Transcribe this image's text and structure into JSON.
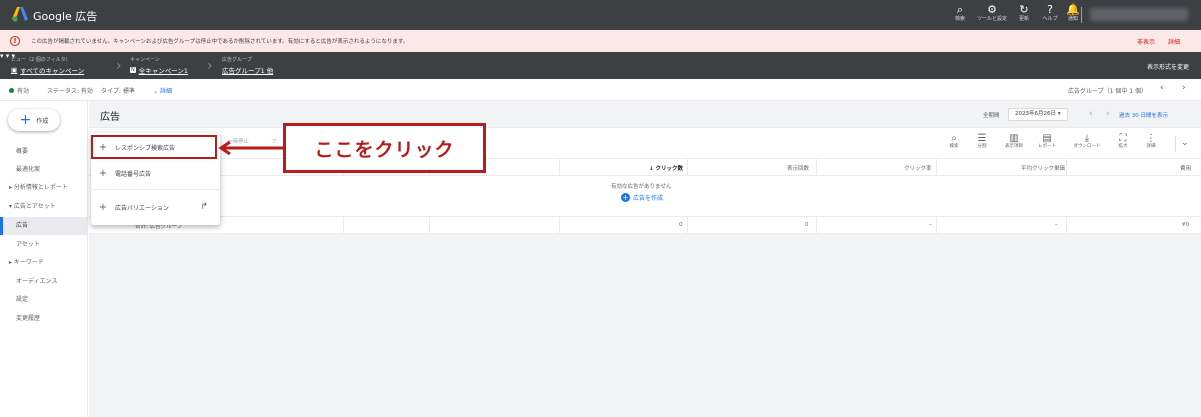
{
  "app": {
    "brand": "Google 広告",
    "tools": [
      {
        "icon": "search-icon",
        "glyph": "⌕",
        "label": "検索"
      },
      {
        "icon": "wrench-icon",
        "glyph": "⚙",
        "label": "ツールと設定"
      },
      {
        "icon": "refresh-icon",
        "glyph": "↻",
        "label": "更新"
      },
      {
        "icon": "help-icon",
        "glyph": "?",
        "label": "ヘルプ"
      },
      {
        "icon": "bell-icon",
        "glyph": "🔔",
        "label": "通知"
      }
    ]
  },
  "alert": {
    "text": "この広告が掲載されていません。キャンペーンおよび広告グループは停止中であるか削除されています。有効にすると広告が表示されるようになります。",
    "hide": "非表示",
    "details": "詳細"
  },
  "nav": {
    "view_small": "ビュー（2 個のフィルタ）",
    "view_label": "すべてのキャンペーン",
    "campaign_small": "キャンペーン",
    "campaign_label": "全キャンペーン1",
    "adgroup_small": "広告グループ",
    "adgroup_label": "広告グループ1 他",
    "right_label": "表示形式を変更"
  },
  "filters": {
    "status_enabled": "有効",
    "status_filter": "ステータス: 有効",
    "type_filter": "タイプ: 標準",
    "more": "詳細",
    "right": "広告グループ（1 個中 1 個）"
  },
  "sidebar": {
    "create": "作成",
    "items": [
      {
        "label": "概要"
      },
      {
        "label": "最適化案"
      },
      {
        "label": "分析情報とレポート"
      },
      {
        "label": "広告とアセット"
      },
      {
        "label": "広告"
      },
      {
        "label": "アセット"
      },
      {
        "label": "キーワード"
      },
      {
        "label": "オーディエンス"
      },
      {
        "label": "設定"
      },
      {
        "label": "変更履歴"
      }
    ]
  },
  "main": {
    "title": "広告",
    "period_label": "全期間",
    "date": "2023年6月26日",
    "date_link": "過去 30 日間を表示",
    "toolbar": [
      {
        "icon": "search-icon",
        "glyph": "⌕",
        "label": "検索"
      },
      {
        "icon": "segment-icon",
        "glyph": "☰",
        "label": "分割"
      },
      {
        "icon": "columns-icon",
        "glyph": "▥",
        "label": "表示項目"
      },
      {
        "icon": "report-icon",
        "glyph": "▤",
        "label": "レポート"
      },
      {
        "icon": "download-icon",
        "glyph": "⤓",
        "label": "ダウンロード"
      },
      {
        "icon": "expand-icon",
        "glyph": "⛶",
        "label": "拡大"
      },
      {
        "icon": "more-icon",
        "glyph": "⋮",
        "label": "詳細"
      }
    ],
    "columns": {
      "clicks": "↓ クリック数",
      "impressions": "表示回数",
      "ctr": "クリック率",
      "avg_cpc": "平均クリック単価",
      "cost": "費用"
    },
    "peek_text": "一時停止",
    "empty": "有効な広告がありません",
    "create_ad": "広告を作成",
    "total": {
      "label": "合計: 広告グループ",
      "clicks": "0",
      "impressions": "0",
      "ctr": "–",
      "avg_cpc": "–",
      "cost": "¥0"
    }
  },
  "menu": {
    "items": [
      {
        "label": "レスポンシブ検索広告"
      },
      {
        "label": "電話番号広告"
      },
      {
        "label": "広告バリエーション"
      }
    ]
  },
  "annotation": {
    "text": "ここをクリック",
    "color": "#b71c1c"
  }
}
